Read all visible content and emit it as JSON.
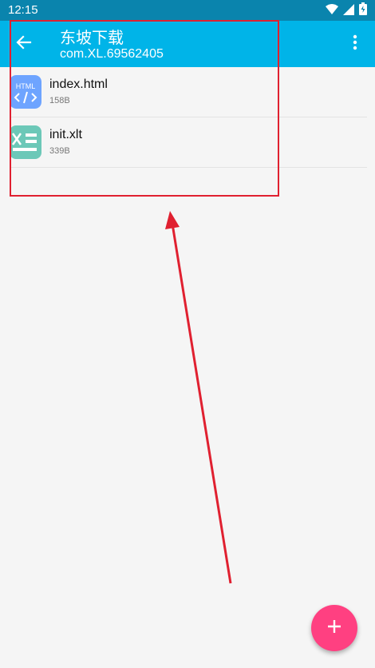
{
  "status_bar": {
    "time": "12:15"
  },
  "app_bar": {
    "title": "东坡下载",
    "subtitle": "com.XL.69562405"
  },
  "files": [
    {
      "name": "index.html",
      "size": "158B",
      "icon": "html-file-icon",
      "icon_label": "HTML",
      "icon_color": "#6ea4ff"
    },
    {
      "name": "init.xlt",
      "size": "339B",
      "icon": "spreadsheet-file-icon",
      "icon_color": "#6cc8b8"
    }
  ],
  "colors": {
    "app_bar": "#00b4e8",
    "status_bar": "#0a84ad",
    "fab": "#ff4081",
    "annotation": "#e02030"
  }
}
